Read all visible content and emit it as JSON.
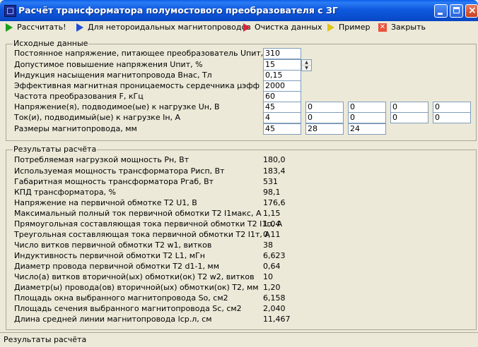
{
  "window": {
    "title": "Расчёт трансформатора полумостового преобразователя с ЗГ"
  },
  "toolbar": {
    "calculate": "Рассчитать!",
    "non_toroidal": "Для нетороидальных магнитопроводов",
    "clear": "Очистка данных",
    "example": "Пример",
    "close": "Закрыть",
    "colors": {
      "calculate": "#1aa01a",
      "non_toroidal": "#1e4fd6",
      "clear": "#d8283a",
      "example": "#e0c41a"
    }
  },
  "input": {
    "title": "Исходные данные",
    "rows": [
      {
        "label": "Постоянное напряжение, питающее преобразователь Uпит, В",
        "values": [
          "310"
        ]
      },
      {
        "label": "Допустимое повышение напряжения Uпит, %",
        "values": [
          "15"
        ]
      },
      {
        "label": "Индукция насыщения магнитопровода Внас, Тл",
        "values": [
          "0,15"
        ]
      },
      {
        "label": "Эффективная магнитная проницаемость сердечника μэфф",
        "values": [
          "2000"
        ]
      },
      {
        "label": "Частота преобразования F, кГц",
        "values": [
          "60"
        ]
      },
      {
        "label": "Напряжение(я), подводимое(ые) к нагрузке Uн, В",
        "values": [
          "45",
          "0",
          "0",
          "0",
          "0"
        ]
      },
      {
        "label": "Ток(и), подводимый(ые) к нагрузке Iн, А",
        "values": [
          "4",
          "0",
          "0",
          "0",
          "0"
        ]
      },
      {
        "label": "Размеры магнитопровода, мм",
        "values": [
          "45",
          "28",
          "24"
        ]
      }
    ]
  },
  "results": {
    "title": "Результаты расчёта",
    "rows": [
      {
        "label": "Потребляемая нагрузкой мощность Pн, Вт",
        "value": "180,0"
      },
      {
        "label": "Используемая мощность трансформатора Pисп, Вт",
        "value": "183,4"
      },
      {
        "label": "Габаритная мощность трансформатора Pгаб, Вт",
        "value": "531"
      },
      {
        "label": "КПД трансформатора, %",
        "value": "98,1"
      },
      {
        "label": "Напряжение на первичной обмотке T2 U1, В",
        "value": "176,6"
      },
      {
        "label": "Максимальный полный ток первичной обмотки T2 I1макс, А",
        "value": "1,15"
      },
      {
        "label": "Прямоугольная составляющая тока первичной обмотки T2 I1п, А",
        "value": "1,04"
      },
      {
        "label": "Треугольная составляющая тока первичной обмотки T2 I1т, А",
        "value": "0,11"
      },
      {
        "label": "Число витков первичной обмотки T2 w1, витков",
        "value": "38"
      },
      {
        "label": "Индуктивность первичной обмотки T2 L1, мГн",
        "value": "6,623"
      },
      {
        "label": "Диаметр провода первичной обмотки T2 d1-1, мм",
        "value": "0,64"
      },
      {
        "label": "Число(а) витков вторичной(ых) обмотки(ок) T2 w2, витков",
        "value": "10"
      },
      {
        "label": "Диаметр(ы) провода(ов) вторичной(ых) обмотки(ок) T2, мм",
        "value": "1,20"
      },
      {
        "label": "Площадь окна выбранного магнитопровода So, см2",
        "value": "6,158"
      },
      {
        "label": "Площадь сечения выбранного магнитопровода Sc, см2",
        "value": "2,040"
      },
      {
        "label": "Длина средней линии магнитопровода lср.л, см",
        "value": "11,467"
      }
    ]
  },
  "status": {
    "text": "Результаты расчёта"
  }
}
